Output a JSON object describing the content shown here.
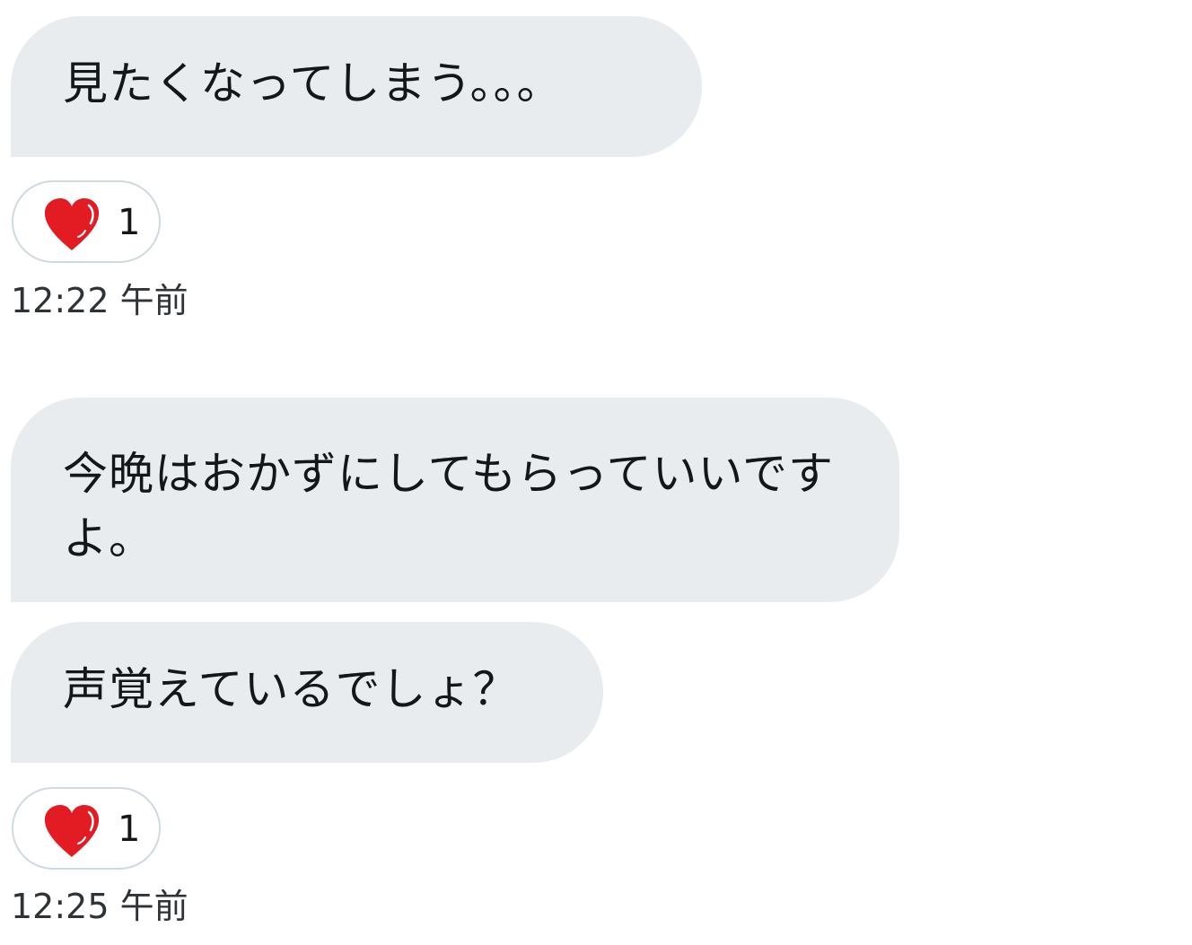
{
  "messages": [
    {
      "text": "見たくなってしまう。。。",
      "reaction": {
        "icon": "heart-icon",
        "count": "1"
      },
      "timestamp": "12:22 午前"
    },
    {
      "text": "今晩はおかずにしてもらっていいですよ。"
    },
    {
      "text": "声覚えているでしょ？",
      "reaction": {
        "icon": "heart-icon",
        "count": "1"
      },
      "timestamp": "12:25 午前"
    }
  ],
  "colors": {
    "bubble_background": "#e8ecee",
    "heart": "#e0245e",
    "text": "#14171a"
  }
}
